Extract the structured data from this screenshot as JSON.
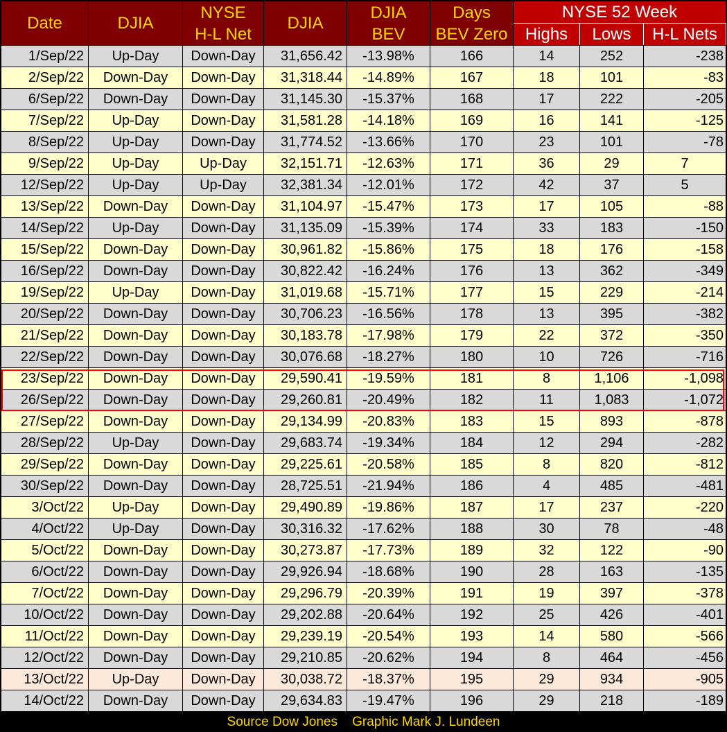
{
  "headers": {
    "date": "Date",
    "djia_dir": "DJIA",
    "nyse_hl_line1": "NYSE",
    "nyse_hl_line2": "H-L Net",
    "djia": "DJIA",
    "bev_line1": "DJIA",
    "bev_line2": "BEV",
    "days_line1": "Days",
    "days_line2": "BEV Zero",
    "group": "NYSE 52 Week",
    "highs": "Highs",
    "lows": "Lows",
    "nets": "H-L Nets"
  },
  "chart_data": {
    "type": "table",
    "columns": [
      "Date",
      "DJIA",
      "NYSE H-L Net",
      "DJIA",
      "DJIA BEV",
      "Days BEV Zero",
      "Highs",
      "Lows",
      "H-L Nets"
    ],
    "column_group": "NYSE 52 Week",
    "rows": [
      [
        "1/Sep/22",
        "Up-Day",
        "Down-Day",
        "31,656.42",
        "-13.98%",
        "166",
        "14",
        "252",
        "-238"
      ],
      [
        "2/Sep/22",
        "Down-Day",
        "Down-Day",
        "31,318.44",
        "-14.89%",
        "167",
        "18",
        "101",
        "-83"
      ],
      [
        "6/Sep/22",
        "Down-Day",
        "Down-Day",
        "31,145.30",
        "-15.37%",
        "168",
        "17",
        "222",
        "-205"
      ],
      [
        "7/Sep/22",
        "Up-Day",
        "Down-Day",
        "31,581.28",
        "-14.18%",
        "169",
        "16",
        "141",
        "-125"
      ],
      [
        "8/Sep/22",
        "Up-Day",
        "Down-Day",
        "31,774.52",
        "-13.66%",
        "170",
        "23",
        "101",
        "-78"
      ],
      [
        "9/Sep/22",
        "Up-Day",
        "Up-Day",
        "32,151.71",
        "-12.63%",
        "171",
        "36",
        "29",
        "7"
      ],
      [
        "12/Sep/22",
        "Up-Day",
        "Up-Day",
        "32,381.34",
        "-12.01%",
        "172",
        "42",
        "37",
        "5"
      ],
      [
        "13/Sep/22",
        "Down-Day",
        "Down-Day",
        "31,104.97",
        "-15.47%",
        "173",
        "17",
        "105",
        "-88"
      ],
      [
        "14/Sep/22",
        "Up-Day",
        "Down-Day",
        "31,135.09",
        "-15.39%",
        "174",
        "33",
        "183",
        "-150"
      ],
      [
        "15/Sep/22",
        "Down-Day",
        "Down-Day",
        "30,961.82",
        "-15.86%",
        "175",
        "18",
        "176",
        "-158"
      ],
      [
        "16/Sep/22",
        "Down-Day",
        "Down-Day",
        "30,822.42",
        "-16.24%",
        "176",
        "13",
        "362",
        "-349"
      ],
      [
        "19/Sep/22",
        "Up-Day",
        "Down-Day",
        "31,019.68",
        "-15.71%",
        "177",
        "15",
        "229",
        "-214"
      ],
      [
        "20/Sep/22",
        "Down-Day",
        "Down-Day",
        "30,706.23",
        "-16.56%",
        "178",
        "13",
        "395",
        "-382"
      ],
      [
        "21/Sep/22",
        "Down-Day",
        "Down-Day",
        "30,183.78",
        "-17.98%",
        "179",
        "22",
        "372",
        "-350"
      ],
      [
        "22/Sep/22",
        "Down-Day",
        "Down-Day",
        "30,076.68",
        "-18.27%",
        "180",
        "10",
        "726",
        "-716"
      ],
      [
        "23/Sep/22",
        "Down-Day",
        "Down-Day",
        "29,590.41",
        "-19.59%",
        "181",
        "8",
        "1,106",
        "-1,098"
      ],
      [
        "26/Sep/22",
        "Down-Day",
        "Down-Day",
        "29,260.81",
        "-20.49%",
        "182",
        "11",
        "1,083",
        "-1,072"
      ],
      [
        "27/Sep/22",
        "Down-Day",
        "Down-Day",
        "29,134.99",
        "-20.83%",
        "183",
        "15",
        "893",
        "-878"
      ],
      [
        "28/Sep/22",
        "Up-Day",
        "Down-Day",
        "29,683.74",
        "-19.34%",
        "184",
        "12",
        "294",
        "-282"
      ],
      [
        "29/Sep/22",
        "Down-Day",
        "Down-Day",
        "29,225.61",
        "-20.58%",
        "185",
        "8",
        "820",
        "-812"
      ],
      [
        "30/Sep/22",
        "Down-Day",
        "Down-Day",
        "28,725.51",
        "-21.94%",
        "186",
        "4",
        "485",
        "-481"
      ],
      [
        "3/Oct/22",
        "Up-Day",
        "Down-Day",
        "29,490.89",
        "-19.86%",
        "187",
        "17",
        "237",
        "-220"
      ],
      [
        "4/Oct/22",
        "Up-Day",
        "Down-Day",
        "30,316.32",
        "-17.62%",
        "188",
        "30",
        "78",
        "-48"
      ],
      [
        "5/Oct/22",
        "Down-Day",
        "Down-Day",
        "30,273.87",
        "-17.73%",
        "189",
        "32",
        "122",
        "-90"
      ],
      [
        "6/Oct/22",
        "Down-Day",
        "Down-Day",
        "29,926.94",
        "-18.68%",
        "190",
        "28",
        "163",
        "-135"
      ],
      [
        "7/Oct/22",
        "Down-Day",
        "Down-Day",
        "29,296.79",
        "-20.39%",
        "191",
        "19",
        "397",
        "-378"
      ],
      [
        "10/Oct/22",
        "Down-Day",
        "Down-Day",
        "29,202.88",
        "-20.64%",
        "192",
        "25",
        "426",
        "-401"
      ],
      [
        "11/Oct/22",
        "Down-Day",
        "Down-Day",
        "29,239.19",
        "-20.54%",
        "193",
        "14",
        "580",
        "-566"
      ],
      [
        "12/Oct/22",
        "Down-Day",
        "Down-Day",
        "29,210.85",
        "-20.62%",
        "194",
        "8",
        "464",
        "-456"
      ],
      [
        "13/Oct/22",
        "Up-Day",
        "Down-Day",
        "30,038.72",
        "-18.37%",
        "195",
        "29",
        "934",
        "-905"
      ],
      [
        "14/Oct/22",
        "Down-Day",
        "Down-Day",
        "29,634.83",
        "-19.47%",
        "196",
        "29",
        "218",
        "-189"
      ]
    ],
    "highlighted_rows": [
      15,
      16
    ],
    "highlight_color": "#ff0000"
  },
  "colors": {
    "header_dark_red": "#7f0000",
    "header_red": "#c00000",
    "header_text": "#ffd600",
    "row_gray": "#d9d9d9",
    "row_yellow": "#ffffcc",
    "row_peach": "#fde9d9"
  },
  "row_shading": [
    "gray",
    "yellow",
    "gray",
    "yellow",
    "gray",
    "yellow",
    "gray",
    "yellow",
    "gray",
    "yellow",
    "gray",
    "yellow",
    "gray",
    "yellow",
    "gray",
    "yellow",
    "gray",
    "yellow",
    "gray",
    "yellow",
    "gray",
    "yellow",
    "gray",
    "yellow",
    "gray",
    "yellow",
    "gray",
    "yellow",
    "gray",
    "peach",
    "gray"
  ],
  "footer": {
    "source": "Source Dow Jones",
    "graphic": "Graphic Mark J. Lundeen"
  }
}
